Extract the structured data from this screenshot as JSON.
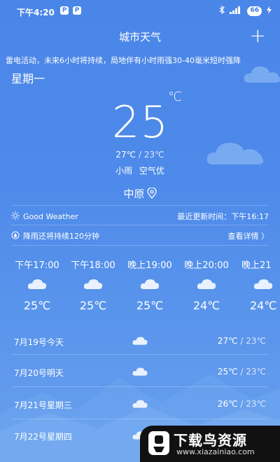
{
  "status_bar": {
    "time": "下午4:20",
    "app_badge_1": "P",
    "app_badge_2": "P",
    "battery": "66",
    "icons": [
      "bluetooth-icon",
      "signal-icon",
      "charging-icon"
    ]
  },
  "header": {
    "title": "城市天气",
    "add_label": "+"
  },
  "alert_text": "雷电活动，未来6小时将持续，局地伴有小时雨强30-40毫米短时强降",
  "current": {
    "weekday": "星期一",
    "temperature": "25",
    "unit": "℃",
    "high": "27℃",
    "range_sep": " / ",
    "low": "23℃",
    "condition": "小雨",
    "air_quality": "空气优",
    "location": "中原"
  },
  "info": {
    "good_weather": "Good Weather",
    "updated": "最近更新时间：下午16:17",
    "rain_notice": "降雨还将持续120分钟",
    "details_link": "查看详情 〉"
  },
  "hourly": [
    {
      "time": "下午17:00",
      "temp": "25℃"
    },
    {
      "time": "下午18:00",
      "temp": "25℃"
    },
    {
      "time": "晚上19:00",
      "temp": "25℃"
    },
    {
      "time": "晚上20:00",
      "temp": "24℃"
    },
    {
      "time": "晚上21",
      "temp": "24℃"
    }
  ],
  "daily": [
    {
      "date": "7月19号今天",
      "high": "27℃",
      "low": "23℃"
    },
    {
      "date": "7月20号明天",
      "high": "25℃",
      "low": "23℃"
    },
    {
      "date": "7月21号星期三",
      "high": "26℃",
      "low": "23℃"
    },
    {
      "date": "7月22号星期四",
      "high": "",
      "low": ""
    }
  ],
  "watermark": {
    "name": "下载鸟资源",
    "url": "www.xiazainiao.com"
  },
  "colors": {
    "background_top": "#4a86e8",
    "background_bottom": "#6aa0ee",
    "text": "#ffffff"
  }
}
